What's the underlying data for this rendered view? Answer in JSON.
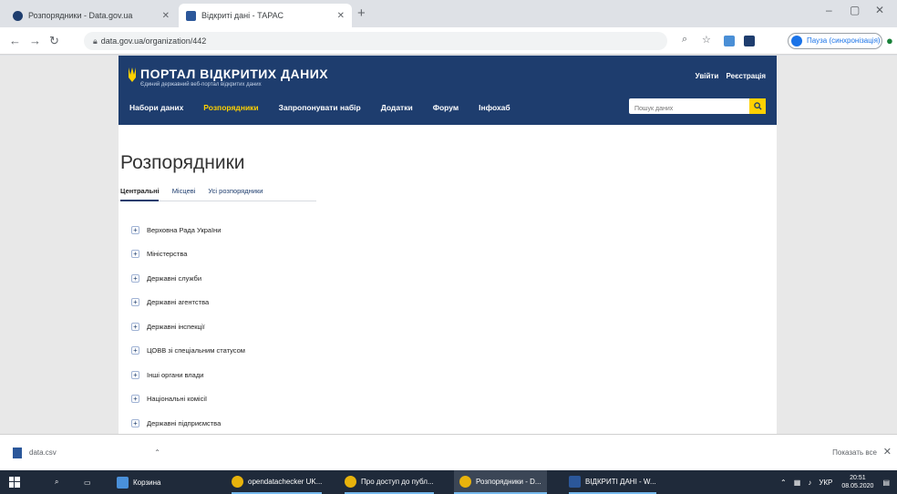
{
  "browser": {
    "tabs": [
      {
        "title": "Розпорядники - Data.gov.ua",
        "active": false
      },
      {
        "title": "Відкриті дані - ТАРАС",
        "active": true
      }
    ],
    "new_tab": "+",
    "window_controls": {
      "minimize": "–",
      "restore": "▢",
      "close": "✕"
    },
    "url": "data.gov.ua/organization/442",
    "profile_label": "Пауза (синхронізація)"
  },
  "site": {
    "logo_title": "ПОРТАЛ ВІДКРИТИХ ДАНИХ",
    "logo_subtitle": "Єдиний державний веб-портал відкритих даних",
    "auth": {
      "login": "Увійти",
      "register": "Реєстрація"
    },
    "nav": [
      {
        "label": "Набори даних",
        "active": false
      },
      {
        "label": "Розпорядники",
        "active": true
      },
      {
        "label": "Запропонувати набір",
        "active": false
      },
      {
        "label": "Додатки",
        "active": false
      },
      {
        "label": "Форум",
        "active": false
      },
      {
        "label": "Інфохаб",
        "active": false
      }
    ],
    "search_placeholder": "Пошук даних",
    "accent": "#ffd100",
    "brand": "#1e3d6e"
  },
  "content": {
    "heading": "Розпорядники",
    "subtabs": [
      {
        "label": "Центральні",
        "active": true
      },
      {
        "label": "Місцеві",
        "active": false
      },
      {
        "label": "Усі розпорядники",
        "active": false
      }
    ],
    "organizations": [
      "Верховна Рада України",
      "Міністерства",
      "Державні служби",
      "Державні агентства",
      "Державні інспекції",
      "ЦОВВ зі спеціальним статусом",
      "Інші органи влади",
      "Національні комісії",
      "Державні підприємства"
    ]
  },
  "downloads": {
    "file": "data.csv",
    "show_all": "Показать все",
    "close": "✕"
  },
  "taskbar": {
    "items": [
      {
        "label": "Корзина",
        "color": "#4a90d9"
      },
      {
        "label": "opendatachecker UK...",
        "color": "#e8b30c"
      },
      {
        "label": "Про доступ до публ...",
        "color": "#e8b30c"
      },
      {
        "label": "Розпорядники - D...",
        "color": "#e8b30c"
      },
      {
        "label": "ВІДКРИТІ ДАНІ - W...",
        "color": "#2b579a"
      }
    ],
    "lang": "УКР",
    "time": "20:51",
    "date": "08.05.2020"
  }
}
